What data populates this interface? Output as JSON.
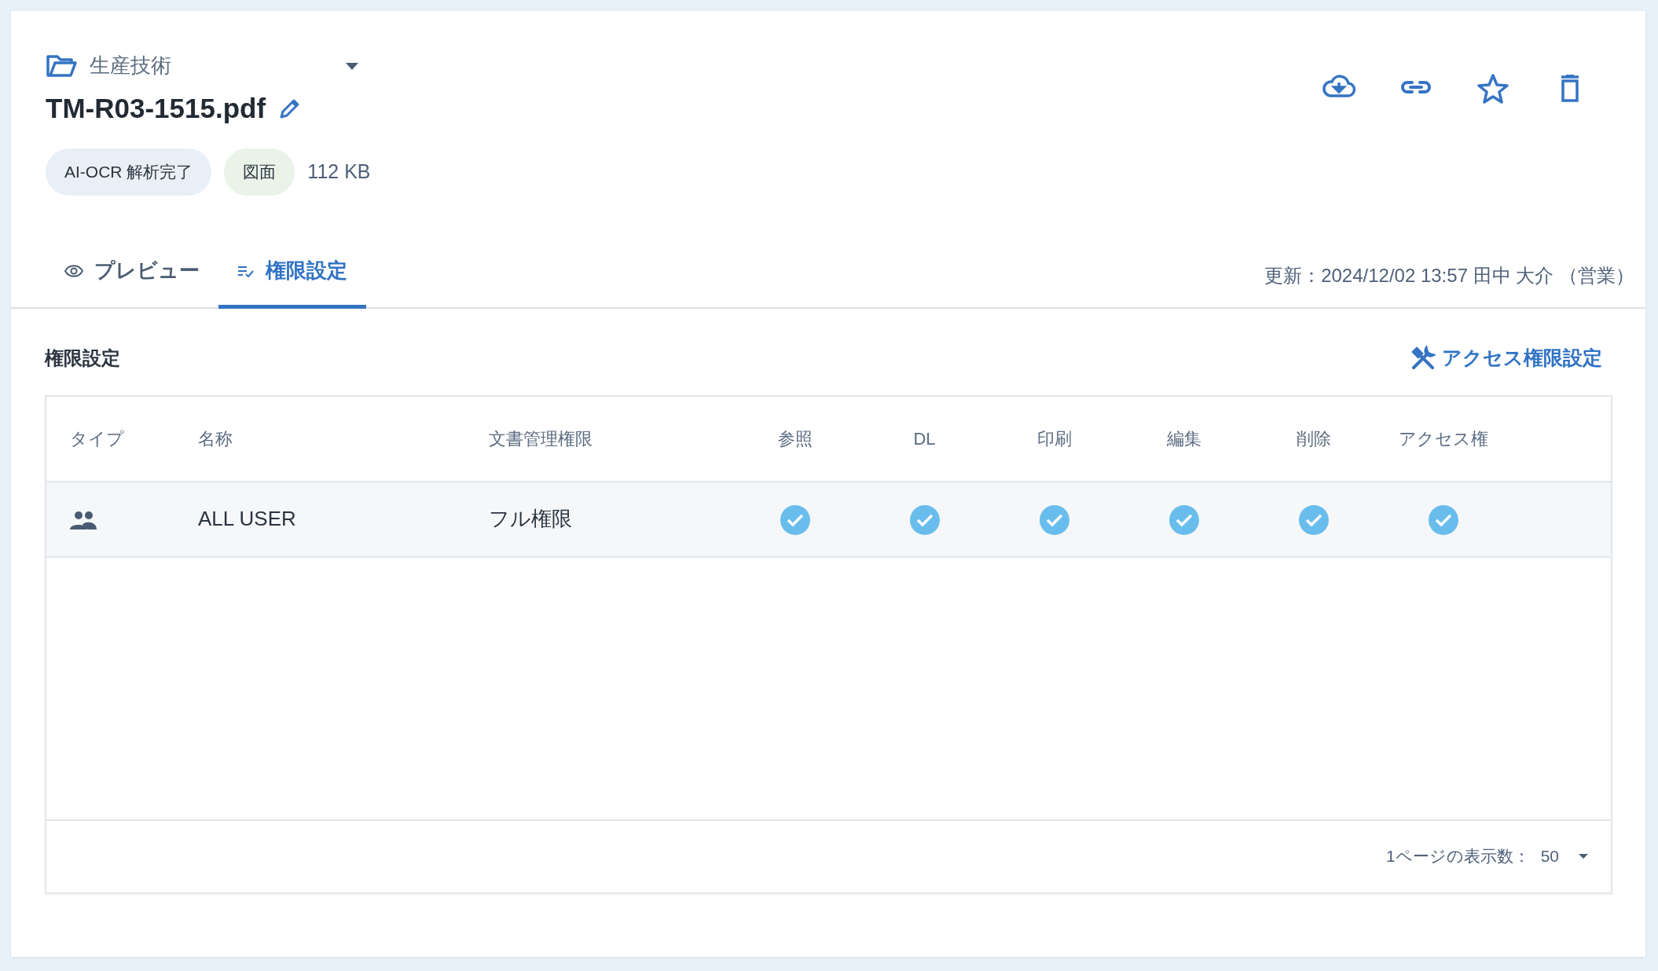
{
  "folder": {
    "name": "生産技術"
  },
  "file": {
    "name": "TM-R03-1515.pdf"
  },
  "badges": [
    {
      "label": "AI-OCR 解析完了",
      "color": "#e9eff6"
    },
    {
      "label": "図面",
      "color": "#e9f3e8"
    }
  ],
  "size": "112 KB",
  "actions": [
    {
      "kind": "download"
    },
    {
      "kind": "link"
    },
    {
      "kind": "star"
    },
    {
      "kind": "trash"
    }
  ],
  "tabs": [
    {
      "label": "プレビュー",
      "kind": "preview",
      "selected": false
    },
    {
      "label": "権限設定",
      "kind": "permissions",
      "selected": true
    }
  ],
  "updated": "更新：2024/12/02 13:57 田中 大介 （営業）",
  "section": {
    "title": "権限設定",
    "action": "アクセス権限設定"
  },
  "table": {
    "columns": [
      "タイプ",
      "名称",
      "文書管理権限",
      "参照",
      "DL",
      "印刷",
      "編集",
      "削除",
      "アクセス権"
    ],
    "rows": [
      {
        "kind": "group",
        "name": "ALL USER",
        "doc_permission": "フル権限",
        "checks": [
          true,
          true,
          true,
          true,
          true,
          true
        ]
      }
    ]
  },
  "footer": {
    "label": "1ページの表示数：",
    "value": "50"
  }
}
